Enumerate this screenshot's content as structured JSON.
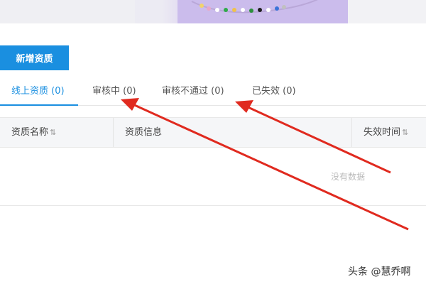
{
  "toolbar": {
    "add_label": "新增资质"
  },
  "tabs": [
    {
      "label": "线上资质 (0)",
      "active": true
    },
    {
      "label": "审核中 (0)",
      "active": false
    },
    {
      "label": "审核不通过 (0)",
      "active": false
    },
    {
      "label": "已失效 (0)",
      "active": false
    }
  ],
  "table": {
    "columns": [
      {
        "label": "资质名称",
        "sortable": true
      },
      {
        "label": "资质信息",
        "sortable": false
      },
      {
        "label": "失效时间",
        "sortable": true
      }
    ],
    "empty_text": "没有数据"
  },
  "icons": {
    "sort": "sort-icon"
  },
  "watermark": "头条 @慧乔啊",
  "colors": {
    "accent": "#1a8fe0",
    "arrow": "#e02a1f"
  }
}
